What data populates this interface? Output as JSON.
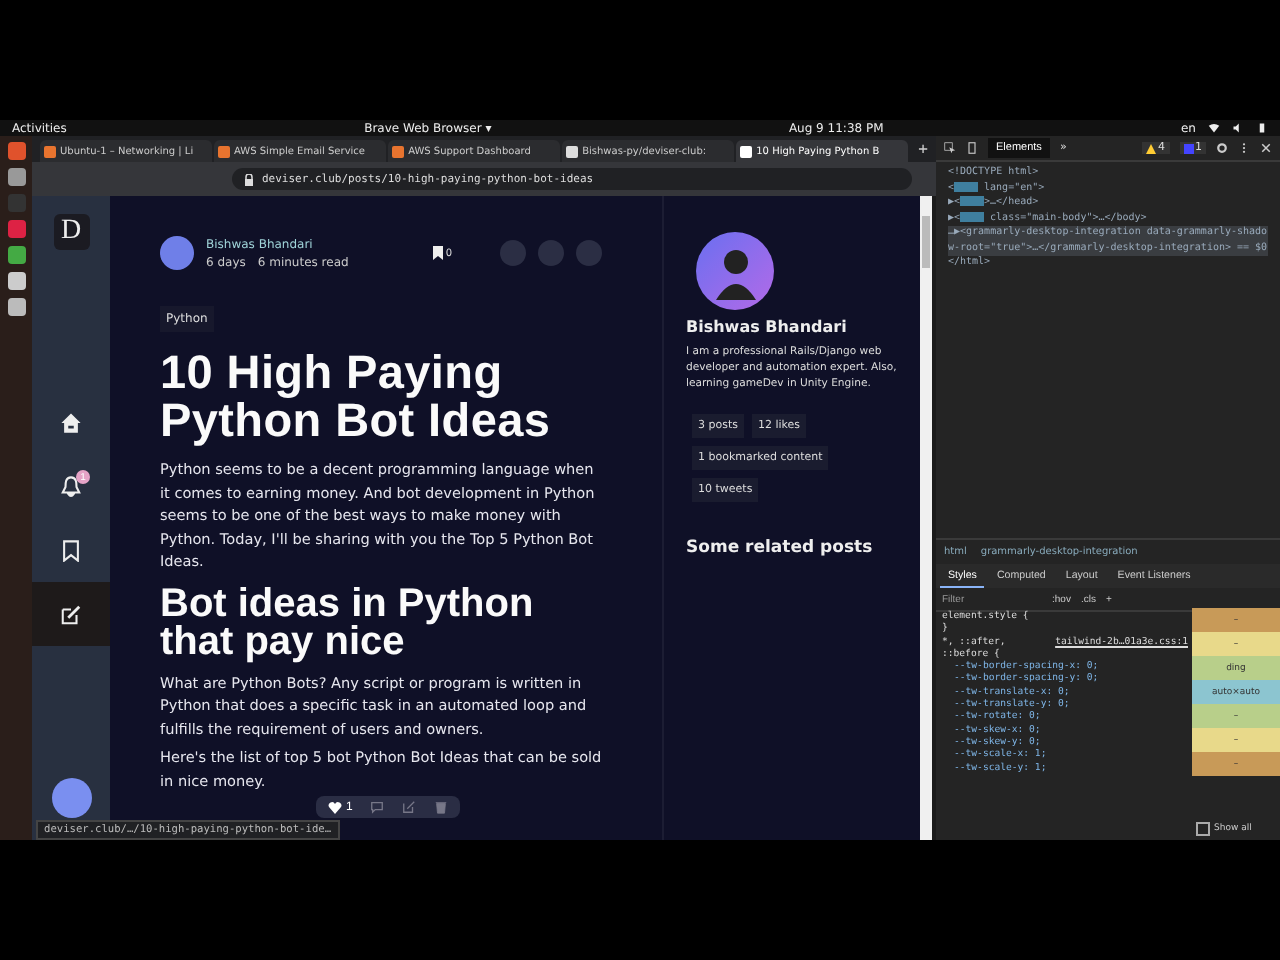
{
  "system_bar": {
    "activities": "Activities",
    "app_menu": "Brave Web Browser",
    "menu_arrow": "▾",
    "clock": "Aug 9  11:38 PM",
    "language": "en"
  },
  "tabs": [
    {
      "title": "Ubuntu-1 – Networking | Li",
      "selected": false
    },
    {
      "title": "AWS Simple Email Service",
      "selected": false
    },
    {
      "title": "AWS Support Dashboard",
      "selected": false
    },
    {
      "title": "Bishwas-py/deviser-club: ",
      "selected": false
    },
    {
      "title": "10 High Paying Python B",
      "selected": true
    }
  ],
  "new_tab": "+",
  "address": "deviser.club/posts/10-high-paying-python-bot-ideas",
  "site_nav": {
    "logo": "D",
    "notification_count": "1"
  },
  "post": {
    "author": "Bishwas Bhandari",
    "age": "6 days",
    "read_time": "6 minutes read",
    "bookmark_count": "0",
    "tag": "Python",
    "title": "10 High Paying Python Bot Ideas",
    "intro": "Python seems to be a decent programming language when it comes to earning money. And bot development in Python seems to be one of the best ways to make money with Python. Today, I'll be sharing with you the Top 5 Python Bot Ideas.",
    "heading": "Bot ideas in Python that pay nice",
    "paragraphs": [
      "What are Python Bots? Any script or program is written in Python that does a specific task in an automated loop and fulfills the requirement of users and owners.",
      "Here's the list of top 5 bot Python Bot Ideas that can be sold in nice money."
    ],
    "likes": "1"
  },
  "profile": {
    "name": "Bishwas Bhandari",
    "bio": "I am a professional Rails/Django web developer and automation expert. Also, learning gameDev in Unity Engine.",
    "stats": [
      "3 posts",
      "12 likes",
      "1 bookmarked content",
      "10 tweets"
    ],
    "related_heading": "Some related posts"
  },
  "devtools": {
    "tabs": [
      {
        "label": "Elements",
        "selected": true
      }
    ],
    "warnings": "4",
    "issues": "1",
    "more_tabs": "»",
    "dom_lines": [
      {
        "before": "<!DOCTYPE html>",
        "masked": false,
        "selected": false
      },
      {
        "before": "<",
        "after": " lang=\"en\">",
        "masked": true,
        "selected": false
      },
      {
        "before": "▶<",
        "after": ">…</head>",
        "masked": true,
        "selected": false
      },
      {
        "before": "▶<",
        "after": " class=\"main-body\">…</body>",
        "masked": true,
        "selected": false
      },
      {
        "before": "…▶<grammarly-desktop-integration data-grammarly-shadow-root=\"true\">…</grammarly-desktop-integration> == $0",
        "masked": false,
        "selected": true
      },
      {
        "before": "</html>",
        "masked": false,
        "selected": false
      }
    ],
    "breadcrumbs": [
      "html",
      "grammarly-desktop-integration"
    ],
    "style_tabs": [
      {
        "label": "Styles",
        "selected": true
      },
      {
        "label": "Computed",
        "selected": false
      },
      {
        "label": "Layout",
        "selected": false
      },
      {
        "label": "Event Listeners",
        "selected": false
      }
    ],
    "filter_placeholder": "Filter",
    "hov": ":hov",
    "cls": ".cls",
    "plus": "+",
    "rule_lines": [
      "element.style {",
      "}",
      "*, ::after,",
      "::before {"
    ],
    "source_link": "tailwind-2b…01a3e.css:1",
    "declarations": [
      "--tw-border-spacing-x: 0;",
      "--tw-border-spacing-y: 0;",
      "--tw-translate-x: 0;",
      "--tw-translate-y: 0;",
      "--tw-rotate: 0;",
      "--tw-skew-x: 0;",
      "--tw-skew-y: 0;",
      "--tw-scale-x: 1;",
      "--tw-scale-y: 1;"
    ],
    "box_model": {
      "padding_label": "ding",
      "content_size": "auto×auto",
      "dash": "–"
    },
    "show_all": "Show all",
    "show_all_checked": false
  },
  "status_url": "deviser.club/…/10-high-paying-python-bot-ide…"
}
